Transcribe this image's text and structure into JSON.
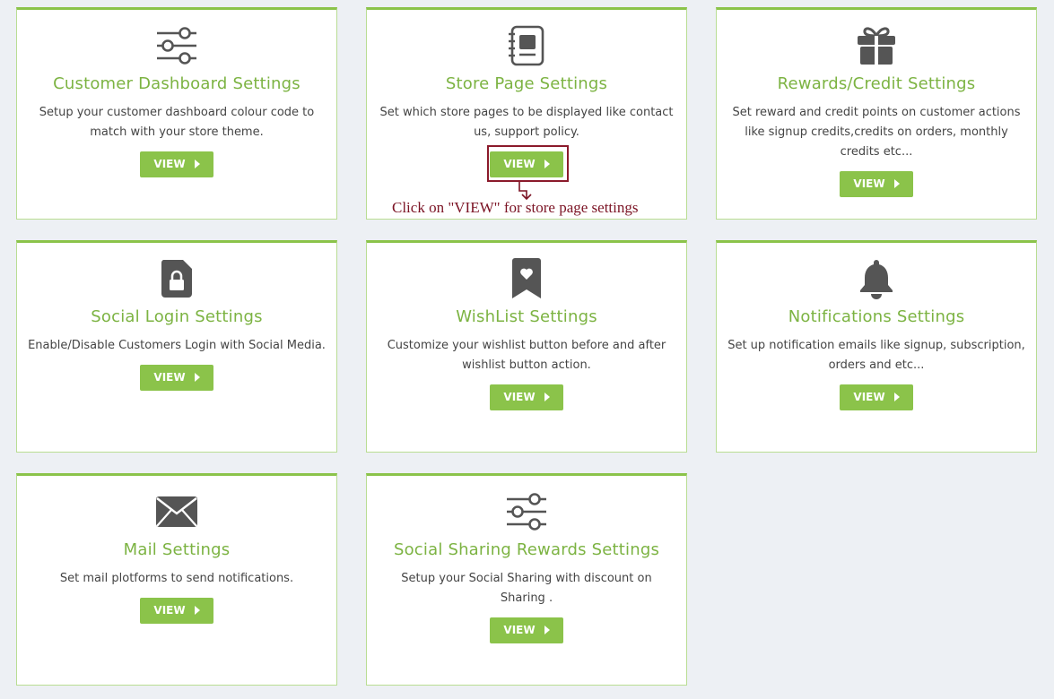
{
  "cards": [
    {
      "icon": "sliders-icon",
      "title": "Customer Dashboard Settings",
      "desc": "Setup your customer dashboard colour code to match with your store theme.",
      "view": "VIEW"
    },
    {
      "icon": "notebook-icon",
      "title": "Store Page Settings",
      "desc": "Set which store pages to be displayed like contact us, support policy.",
      "view": "VIEW"
    },
    {
      "icon": "gift-icon",
      "title": "Rewards/Credit Settings",
      "desc": "Set reward and credit points on customer actions like signup credits,credits on orders, monthly credits etc...",
      "view": "VIEW"
    },
    {
      "icon": "file-lock-icon",
      "title": "Social Login Settings",
      "desc": "Enable/Disable Customers Login with Social Media.",
      "view": "VIEW"
    },
    {
      "icon": "bookmark-heart-icon",
      "title": "WishList Settings",
      "desc": "Customize your wishlist button before and after wishlist button action.",
      "view": "VIEW"
    },
    {
      "icon": "bell-icon",
      "title": "Notifications Settings",
      "desc": "Set up notification emails like signup, subscription, orders and etc...",
      "view": "VIEW"
    },
    {
      "icon": "envelope-icon",
      "title": "Mail Settings",
      "desc": "Set mail plotforms to send notifications.",
      "view": "VIEW"
    },
    {
      "icon": "sliders-icon",
      "title": "Social Sharing Rewards Settings",
      "desc": "Setup your Social Sharing with discount on Sharing .",
      "view": "VIEW"
    }
  ],
  "annotation": {
    "text": "Click on \"VIEW\" for store page settings"
  },
  "colors": {
    "accent": "#8bc34a",
    "title": "#7cb342",
    "annotation": "#7b1324",
    "icon": "#555555"
  }
}
